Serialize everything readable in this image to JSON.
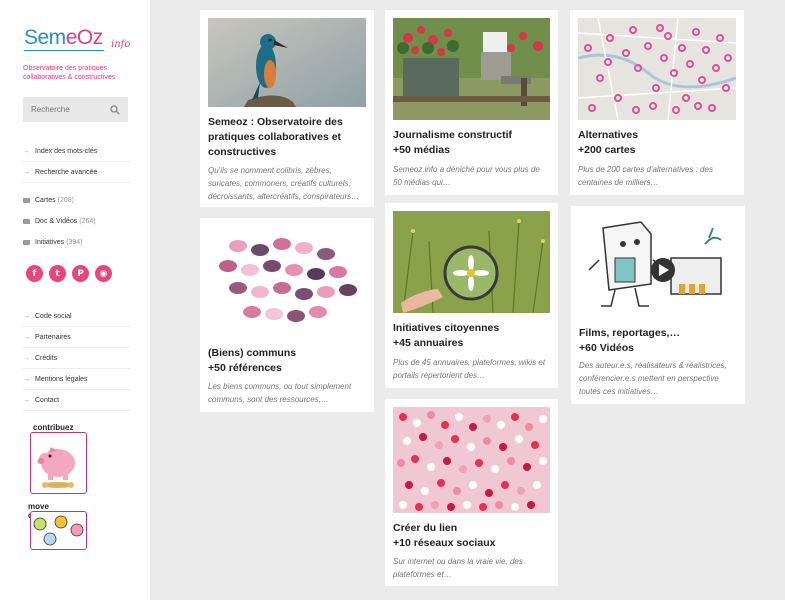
{
  "logo": {
    "text_main": "Sem",
    "text_oz": "eOz",
    "text_sub": "info"
  },
  "tagline": "Observatoire des pratiques collaboratives & constructives",
  "search": {
    "placeholder": "Recherche"
  },
  "nav_top": [
    {
      "label": "Index des mots-clés"
    },
    {
      "label": "Recherche avancée"
    }
  ],
  "categories": [
    {
      "label": "Cartes",
      "count": "(208)"
    },
    {
      "label": "Doc & Vidéos",
      "count": "(264)"
    },
    {
      "label": "Initiatives",
      "count": "(394)"
    }
  ],
  "socials": [
    {
      "icon": "facebook-icon",
      "glyph": "f"
    },
    {
      "icon": "twitter-icon",
      "glyph": "t"
    },
    {
      "icon": "pinterest-icon",
      "glyph": "P"
    },
    {
      "icon": "rss-icon",
      "glyph": "◉"
    }
  ],
  "nav_bottom": [
    {
      "label": "Code social"
    },
    {
      "label": "Partenaires"
    },
    {
      "label": "Crédits"
    },
    {
      "label": "Mentions légales"
    },
    {
      "label": "Contact"
    }
  ],
  "contribuez": "contribuez",
  "move_commons": {
    "line1": "move",
    "line2": "commons"
  },
  "cards": [
    {
      "title1": "Semeoz : Observatoire des",
      "title2": "pratiques collaboratives et",
      "title3": "constructives",
      "desc1": "Qu'ils se nomment colibris, zèbres,",
      "desc2": "suricates, commoners, créatifs culturels,",
      "desc3": "décroissants, altercréatifs, conspirateurs…"
    },
    {
      "title1": "Journalisme constructif",
      "title2": "+50 médias",
      "desc1": "Semeoz.info a déniché pour vous plus de",
      "desc2": "50 médias qui…"
    },
    {
      "title1": "Alternatives",
      "title2": "+200 cartes",
      "desc1": "Plus de 200 cartes d'alternatives : des",
      "desc2": "centaines de milliers…"
    },
    {
      "title1": "(Biens) communs",
      "title2": "+50 références",
      "desc1": "Les biens communs, ou tout simplement",
      "desc2": "communs, sont des ressources,…"
    },
    {
      "title1": "Initiatives citoyennes",
      "title2": "+45 annuaires",
      "desc1": "Plus de 45 annuaires, plateformes, wikis et",
      "desc2": "portails répertorient des…"
    },
    {
      "title1": "Films, reportages,…",
      "title2": "+60 Vidéos",
      "desc1": "Des auteur.e.s, réalisateurs & réalistrices,",
      "desc2": "conférencier.e.s mettent en perspective",
      "desc3": "toutes ces initiatives…"
    },
    {
      "title1": "Créer du lien",
      "title2": "+10 réseaux sociaux",
      "desc1": "Sur internet ou dans la vraie vie, des",
      "desc2": "plateformes et…"
    }
  ]
}
